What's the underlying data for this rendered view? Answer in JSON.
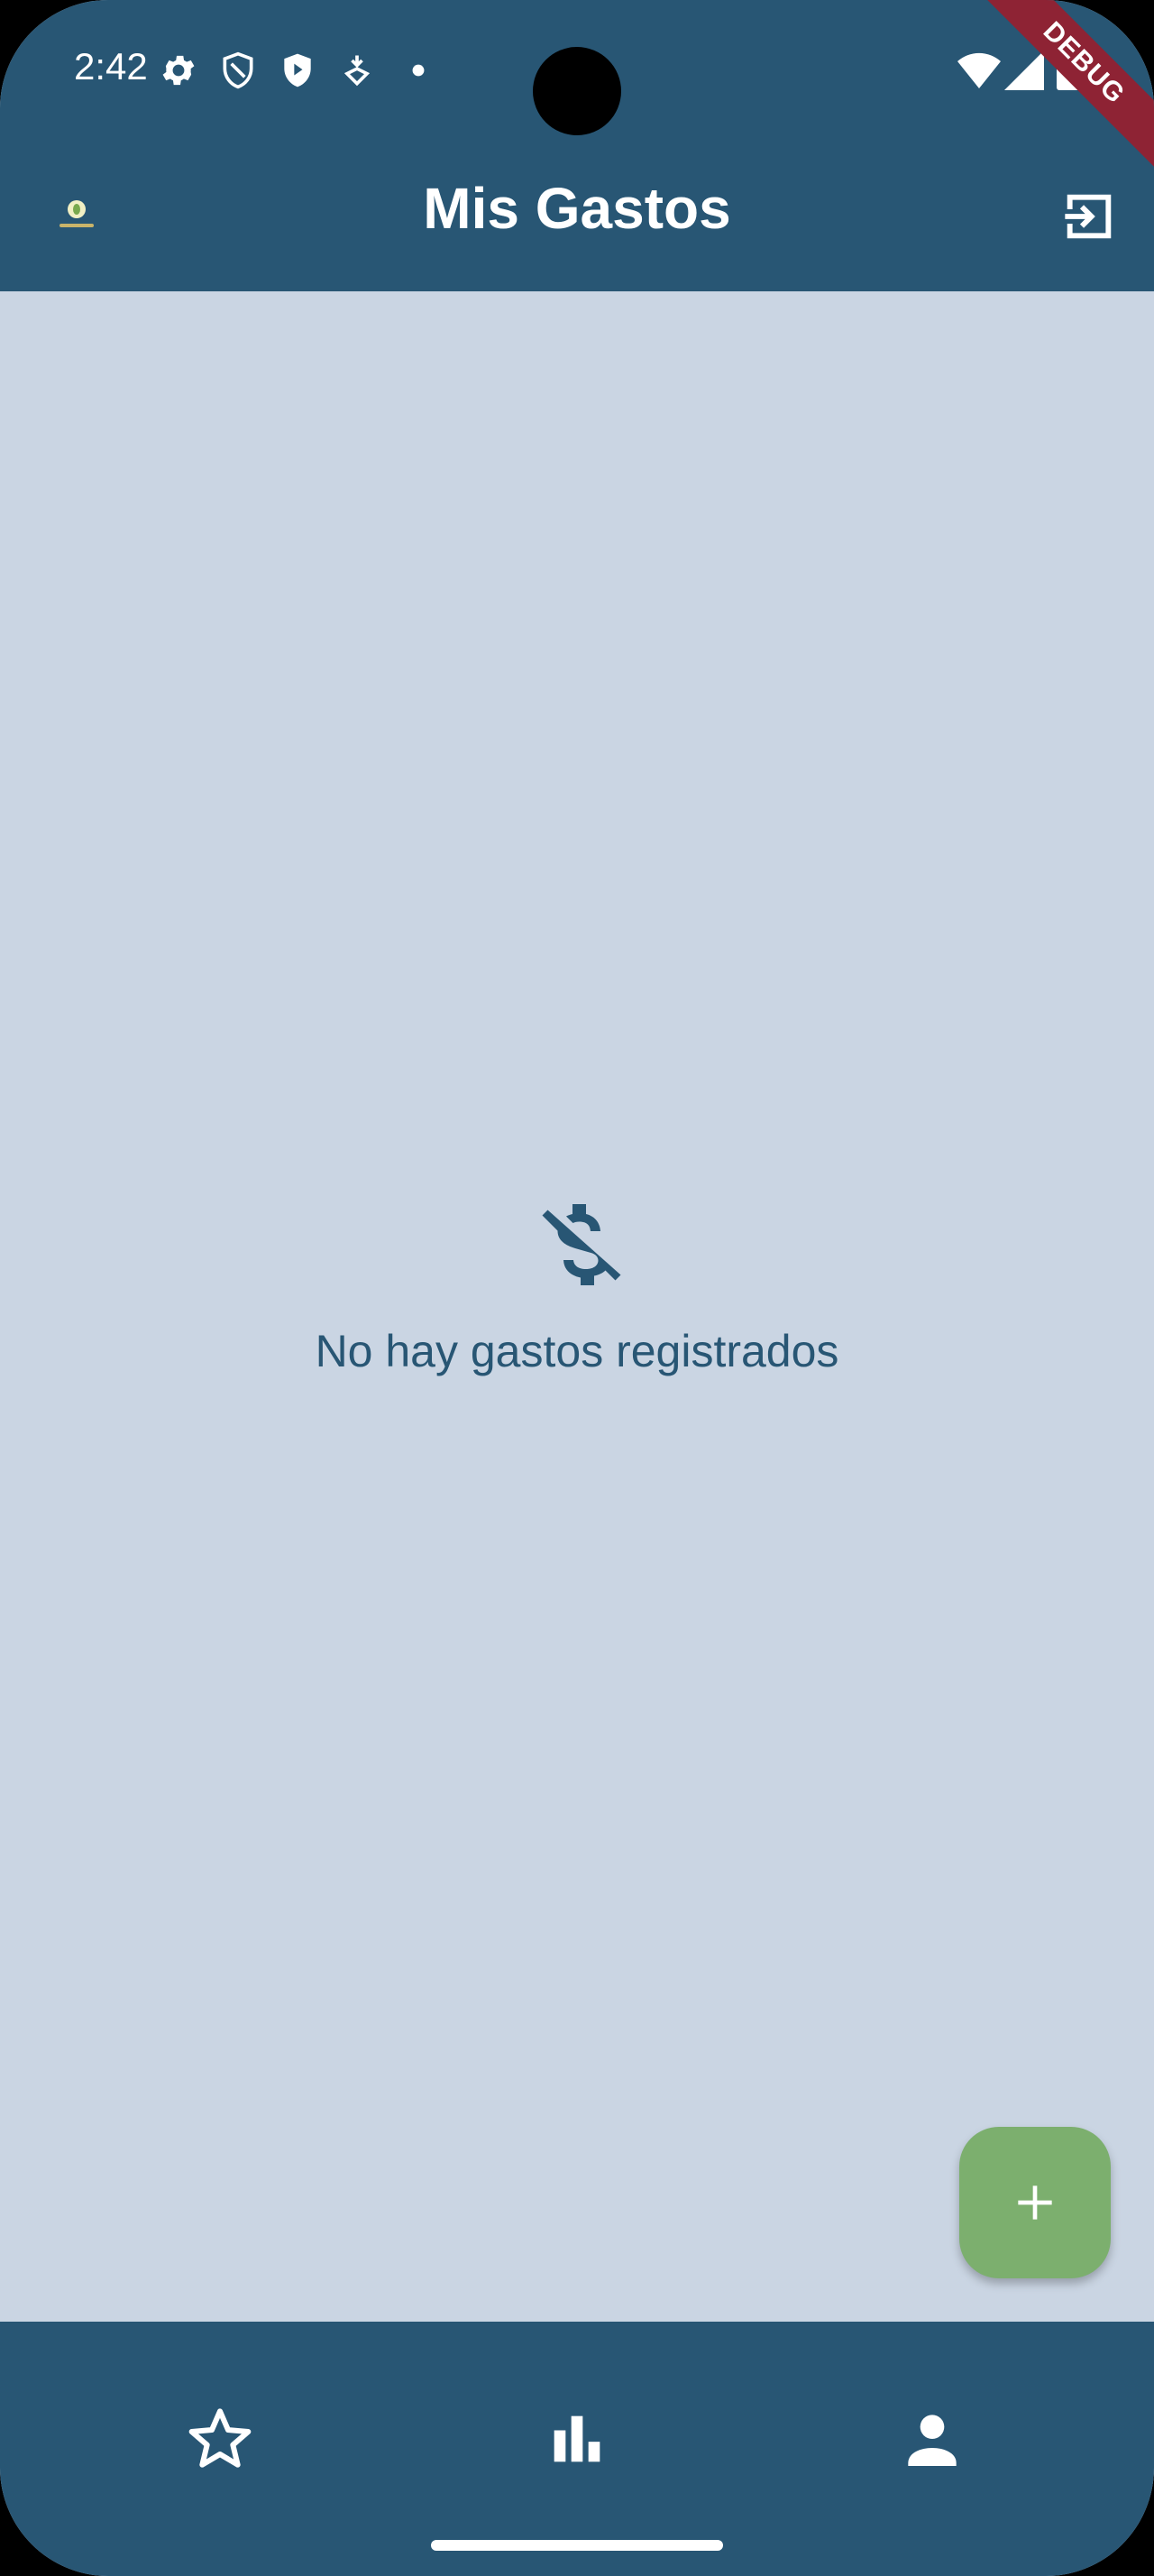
{
  "status_bar": {
    "time": "2:42",
    "left_icons": [
      "settings-gear-icon",
      "shield-outline-icon",
      "shield-play-icon",
      "location-download-icon",
      "dot-icon"
    ],
    "right_icons": [
      "wifi-icon",
      "signal-icon",
      "battery-icon"
    ]
  },
  "debug_banner": "DEBUG",
  "app_bar": {
    "title": "Mis Gastos",
    "logo_icon": "app-logo-icon",
    "action_icon": "logout-icon"
  },
  "empty_state": {
    "icon": "money-off-icon",
    "message": "No hay gastos registrados"
  },
  "fab": {
    "icon": "add-icon"
  },
  "bottom_nav": {
    "items": [
      {
        "icon": "star-outline-icon"
      },
      {
        "icon": "bar-chart-icon"
      },
      {
        "icon": "person-icon"
      }
    ]
  },
  "colors": {
    "primary": "#285674",
    "background": "#cad5e3",
    "fab": "#7caf6e",
    "debug": "#8e2334"
  }
}
